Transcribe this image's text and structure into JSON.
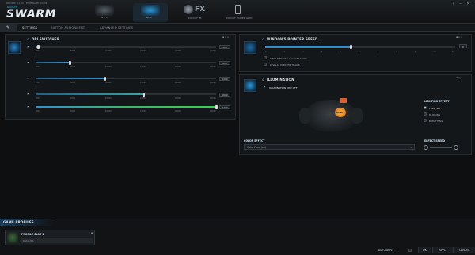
{
  "header": {
    "version": "DRIVER: V1.01 / FIRMWARE: V1.31",
    "brand": "SWARM",
    "brand_prefix": "ROCCAT",
    "nav": [
      {
        "label": "NYTH",
        "icon": "mouse-nyth-icon"
      },
      {
        "label": "KONE",
        "icon": "mouse-kone-icon"
      },
      {
        "label": "ROCCAT FX",
        "icon": "fx-icon"
      },
      {
        "label": "ROCCAT POWER GRID",
        "icon": "phone-icon"
      }
    ],
    "fx_text": "FX",
    "window_buttons": [
      "?",
      "–",
      "✕"
    ]
  },
  "tabs": [
    {
      "label": "SETTINGS",
      "icon": "wrench-icon"
    },
    {
      "label": "BUTTON ASSIGNMENT"
    },
    {
      "label": "ADVANCED SETTINGS"
    }
  ],
  "dpi_panel": {
    "title": "DPI SWITCHER",
    "ticks": [
      "250",
      "5000",
      "10000",
      "15000",
      "20000",
      "25000"
    ],
    "rows": [
      {
        "value": "400",
        "fraction": 0.015,
        "fill": "#cfd6dc"
      },
      {
        "value": "800",
        "fraction": 0.19,
        "fill": "#3a91c8"
      },
      {
        "value": "1200",
        "fraction": 0.385,
        "fill": "#2f90cc"
      },
      {
        "value": "1600",
        "fraction": 0.6,
        "fill": "#37a5a0"
      },
      {
        "value": "3200",
        "fraction": 1.0,
        "fill": "#3ad04a"
      }
    ]
  },
  "pointer_panel": {
    "title": "WINDOWS POINTER SPEED",
    "value": "6",
    "fraction": 0.45,
    "ticks": [
      "1",
      "2",
      "3",
      "4",
      "5",
      "6",
      "7",
      "8",
      "9",
      "10",
      "11"
    ],
    "options": [
      "SINGLE MOUSE ACCELERATION",
      "DISPLAY POINTER TRAILS"
    ]
  },
  "illumination_panel": {
    "title": "ILLUMINATION",
    "toggle": "ILLUMINATION ON / OFF",
    "lighting_title": "LIGHTING EFFECT",
    "lighting_options": [
      {
        "label": "FULLY LIT",
        "on": true
      },
      {
        "label": "BLINKING",
        "on": false
      },
      {
        "label": "BREATHING",
        "on": false
      }
    ],
    "color_title": "COLOR EFFECT",
    "color_value": "Color Flow (on)",
    "speed_title": "EFFECT SPEED",
    "mouse_logo": "KONE"
  },
  "game_profiles": {
    "title": "GAME PROFILES",
    "profile_name": "PROFILE SLOT 1",
    "profile_sub": "Default 1"
  },
  "footer": {
    "auto_apply": "AUTO APPLY",
    "ok": "OK",
    "apply": "APPLY",
    "cancel": "CANCEL"
  },
  "colors": {
    "accent": "#1db3ff",
    "background": "#0d0f11"
  }
}
